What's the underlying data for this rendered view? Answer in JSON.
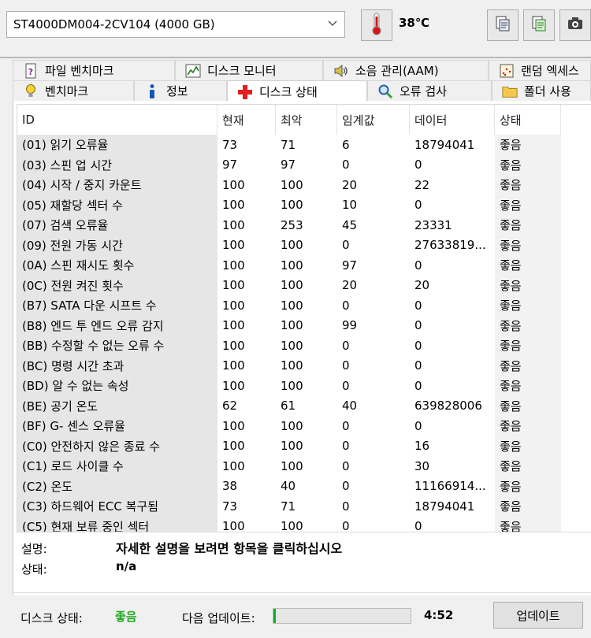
{
  "toolbar": {
    "drive": "ST4000DM004-2CV104 (4000 GB)",
    "temperature": "38℃"
  },
  "tabs_top": [
    {
      "label": "파일 벤치마크",
      "icon": "file-benchmark-icon"
    },
    {
      "label": "디스크 모니터",
      "icon": "disk-monitor-icon"
    },
    {
      "label": "소음 관리(AAM)",
      "icon": "speaker-icon"
    },
    {
      "label": "랜덤 엑세스",
      "icon": "random-access-icon"
    }
  ],
  "tabs_bottom": [
    {
      "label": "벤치마크",
      "icon": "lightbulb-icon"
    },
    {
      "label": "정보",
      "icon": "info-icon"
    },
    {
      "label": "디스크 상태",
      "icon": "health-cross-icon"
    },
    {
      "label": "오류 검사",
      "icon": "magnifier-icon"
    },
    {
      "label": "폴더 사용",
      "icon": "folder-icon"
    }
  ],
  "table": {
    "headers": [
      "ID",
      "현재",
      "최악",
      "임계값",
      "데이터",
      "상태"
    ],
    "rows": [
      [
        "(01) 읽기 오류율",
        "73",
        "71",
        "6",
        "18794041",
        "좋음"
      ],
      [
        "(03) 스핀 업 시간",
        "97",
        "97",
        "0",
        "0",
        "좋음"
      ],
      [
        "(04) 시작 / 중지 카운트",
        "100",
        "100",
        "20",
        "22",
        "좋음"
      ],
      [
        "(05) 재할당 섹터 수",
        "100",
        "100",
        "10",
        "0",
        "좋음"
      ],
      [
        "(07) 검색 오류율",
        "100",
        "253",
        "45",
        "23331",
        "좋음"
      ],
      [
        "(09) 전원 가동 시간",
        "100",
        "100",
        "0",
        "27633819...",
        "좋음"
      ],
      [
        "(0A) 스핀 재시도 횟수",
        "100",
        "100",
        "97",
        "0",
        "좋음"
      ],
      [
        "(0C) 전원 켜진 횟수",
        "100",
        "100",
        "20",
        "20",
        "좋음"
      ],
      [
        "(B7) SATA 다운 시프트 수",
        "100",
        "100",
        "0",
        "0",
        "좋음"
      ],
      [
        "(B8) 엔드 투 엔드 오류 감지",
        "100",
        "100",
        "99",
        "0",
        "좋음"
      ],
      [
        "(BB) 수정할 수 없는 오류 수",
        "100",
        "100",
        "0",
        "0",
        "좋음"
      ],
      [
        "(BC) 명령 시간 초과",
        "100",
        "100",
        "0",
        "0",
        "좋음"
      ],
      [
        "(BD) 알 수 없는 속성",
        "100",
        "100",
        "0",
        "0",
        "좋음"
      ],
      [
        "(BE) 공기 온도",
        "62",
        "61",
        "40",
        "639828006",
        "좋음"
      ],
      [
        "(BF) G- 센스 오류율",
        "100",
        "100",
        "0",
        "0",
        "좋음"
      ],
      [
        "(C0) 안전하지 않은 종료 수",
        "100",
        "100",
        "0",
        "16",
        "좋음"
      ],
      [
        "(C1) 로드 사이클 수",
        "100",
        "100",
        "0",
        "30",
        "좋음"
      ],
      [
        "(C2) 온도",
        "38",
        "40",
        "0",
        "11166914...",
        "좋음"
      ],
      [
        "(C3) 하드웨어 ECC 복구됨",
        "73",
        "71",
        "0",
        "18794041",
        "좋음"
      ],
      [
        "(C5) 현재 보류 중인 섹터",
        "100",
        "100",
        "0",
        "0",
        "좋음"
      ]
    ]
  },
  "info": {
    "desc_label": "설명:",
    "desc_value": "자세한 설명을 보려면 항목을 클릭하십시오",
    "state_label": "상태:",
    "state_value": "n/a"
  },
  "footer": {
    "disk_state_label": "디스크 상태:",
    "disk_state_value": "좋음",
    "next_update_label": "다음 업데이트:",
    "progress_fraction": 0.02,
    "timer": "4:52",
    "update_button": "업데이트"
  },
  "colors": {
    "good": "#22a822",
    "progress": "#06b025"
  }
}
